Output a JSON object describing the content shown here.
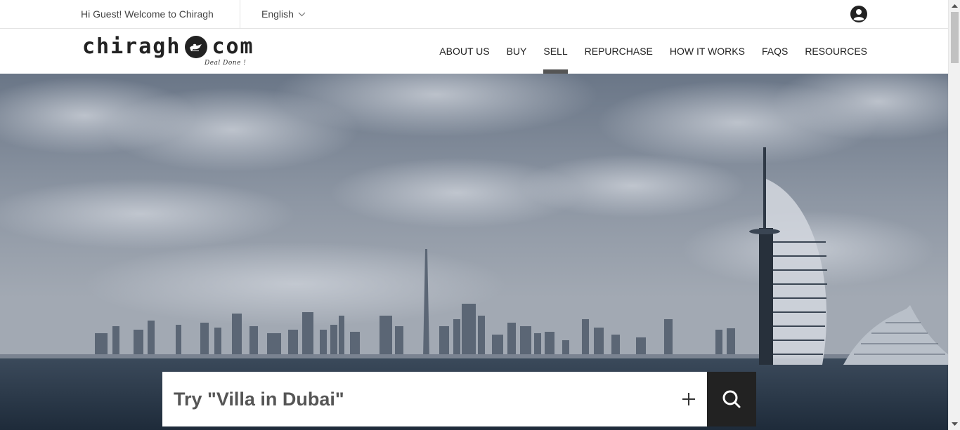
{
  "topbar": {
    "welcome": "Hi Guest! Welcome to Chiragh",
    "language": "English"
  },
  "logo": {
    "left_text": "chiragh",
    "right_text": "com",
    "tagline": "Deal Done !"
  },
  "nav": {
    "items": [
      {
        "label": "ABOUT US"
      },
      {
        "label": "BUY"
      },
      {
        "label": "SELL"
      },
      {
        "label": "REPURCHASE"
      },
      {
        "label": "HOW IT WORKS"
      },
      {
        "label": "FAQS"
      },
      {
        "label": "RESOURCES"
      }
    ],
    "active": "SELL"
  },
  "search": {
    "placeholder": "Try \"Villa in Dubai\""
  },
  "icons": {
    "user": "user-circle-icon",
    "chevron": "chevron-down-icon",
    "plus": "plus-icon",
    "search": "search-icon",
    "lamp": "lamp-icon"
  },
  "colors": {
    "nav_active_indicator": "#555555",
    "search_button": "#222222",
    "hero_sky": "#8690a0",
    "hero_sea": "#243244"
  }
}
